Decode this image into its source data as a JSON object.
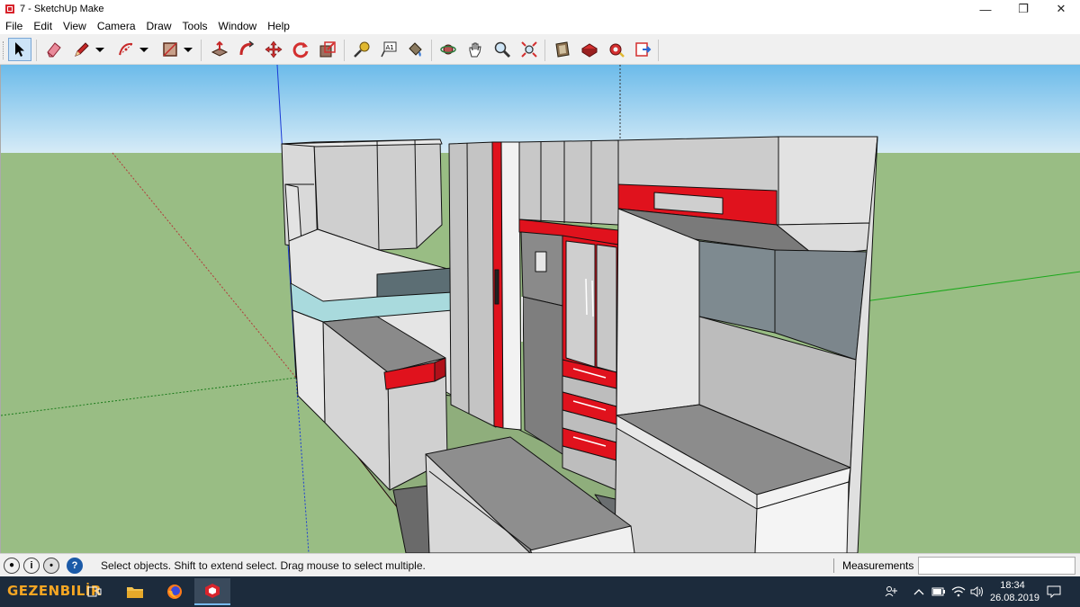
{
  "window": {
    "title": "7 - SketchUp Make",
    "minimize": "—",
    "restore": "❐",
    "close": "✕"
  },
  "menu": [
    "File",
    "Edit",
    "View",
    "Camera",
    "Draw",
    "Tools",
    "Window",
    "Help"
  ],
  "toolbar": {
    "tools": [
      {
        "name": "select-tool-icon",
        "active": true
      },
      {
        "name": "eraser-tool-icon"
      },
      {
        "name": "pencil-line-tool-icon"
      },
      {
        "name": "line-dropdown-icon"
      },
      {
        "name": "arc-tool-icon"
      },
      {
        "name": "arc-dropdown-icon"
      },
      {
        "name": "rectangle-tool-icon"
      },
      {
        "name": "shape-dropdown-icon"
      },
      {
        "name": "push-pull-tool-icon"
      },
      {
        "name": "follow-me-tool-icon"
      },
      {
        "name": "move-tool-icon"
      },
      {
        "name": "rotate-tool-icon"
      },
      {
        "name": "scale-tool-icon"
      },
      {
        "name": "tape-measure-tool-icon"
      },
      {
        "name": "text-tool-icon"
      },
      {
        "name": "paint-bucket-tool-icon"
      },
      {
        "name": "orbit-tool-icon"
      },
      {
        "name": "pan-tool-icon"
      },
      {
        "name": "zoom-tool-icon"
      },
      {
        "name": "zoom-extents-tool-icon"
      },
      {
        "name": "3d-warehouse-icon"
      },
      {
        "name": "extension-warehouse-icon"
      },
      {
        "name": "extension-manager-icon"
      },
      {
        "name": "send-to-layout-icon"
      }
    ],
    "text_tool_glyph": "A1"
  },
  "status": {
    "hint": "Select objects. Shift to extend select. Drag mouse to select multiple.",
    "measurements_label": "Measurements",
    "measurements_value": "",
    "info_glyph": "i",
    "help_glyph": "?"
  },
  "taskbar": {
    "brand": "GEZENBILİR",
    "time": "18:34",
    "date": "26.08.2019"
  },
  "colors": {
    "sky": "#7ac2ec",
    "ground": "#99bd84",
    "accent_red": "#e0121d",
    "taskbar": "#1c2b3c"
  }
}
